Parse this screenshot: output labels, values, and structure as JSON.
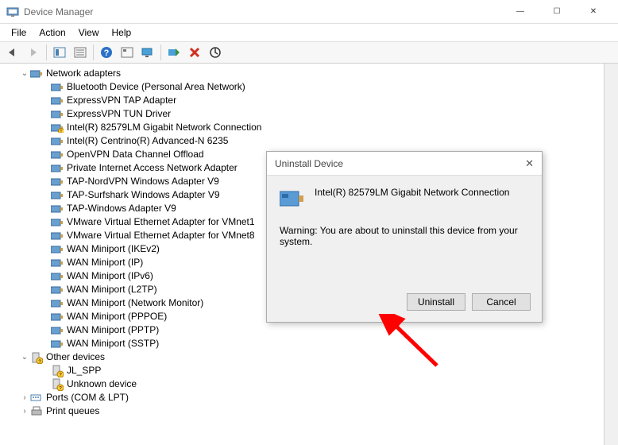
{
  "window": {
    "title": "Device Manager",
    "controls": {
      "min": "—",
      "max": "☐",
      "close": "✕"
    }
  },
  "menu": {
    "file": "File",
    "action": "Action",
    "view": "View",
    "help": "Help"
  },
  "toolbar_icons": {
    "back": "back-arrow",
    "forward": "forward-arrow",
    "folder": "folder",
    "list": "list",
    "help": "help",
    "props": "properties",
    "monitor": "monitor",
    "scan": "scan",
    "delete": "delete",
    "update": "update"
  },
  "tree": {
    "cat_network": "Network adapters",
    "adapters": [
      "Bluetooth Device (Personal Area Network)",
      "ExpressVPN TAP Adapter",
      "ExpressVPN TUN Driver",
      "Intel(R) 82579LM Gigabit Network Connection",
      "Intel(R) Centrino(R) Advanced-N 6235",
      "OpenVPN Data Channel Offload",
      "Private Internet Access Network Adapter",
      "TAP-NordVPN Windows Adapter V9",
      "TAP-Surfshark Windows Adapter V9",
      "TAP-Windows Adapter V9",
      "VMware Virtual Ethernet Adapter for VMnet1",
      "VMware Virtual Ethernet Adapter for VMnet8",
      "WAN Miniport (IKEv2)",
      "WAN Miniport (IP)",
      "WAN Miniport (IPv6)",
      "WAN Miniport (L2TP)",
      "WAN Miniport (Network Monitor)",
      "WAN Miniport (PPPOE)",
      "WAN Miniport (PPTP)",
      "WAN Miniport (SSTP)"
    ],
    "warning_item_index": 3,
    "cat_other": "Other devices",
    "other_devices": [
      "JL_SPP",
      "Unknown device"
    ],
    "cat_ports": "Ports (COM & LPT)",
    "cat_print": "Print queues"
  },
  "dialog": {
    "title": "Uninstall Device",
    "device_name": "Intel(R) 82579LM Gigabit Network Connection",
    "warning_text": "Warning: You are about to uninstall this device from your system.",
    "btn_uninstall": "Uninstall",
    "btn_cancel": "Cancel",
    "close_glyph": "✕"
  }
}
